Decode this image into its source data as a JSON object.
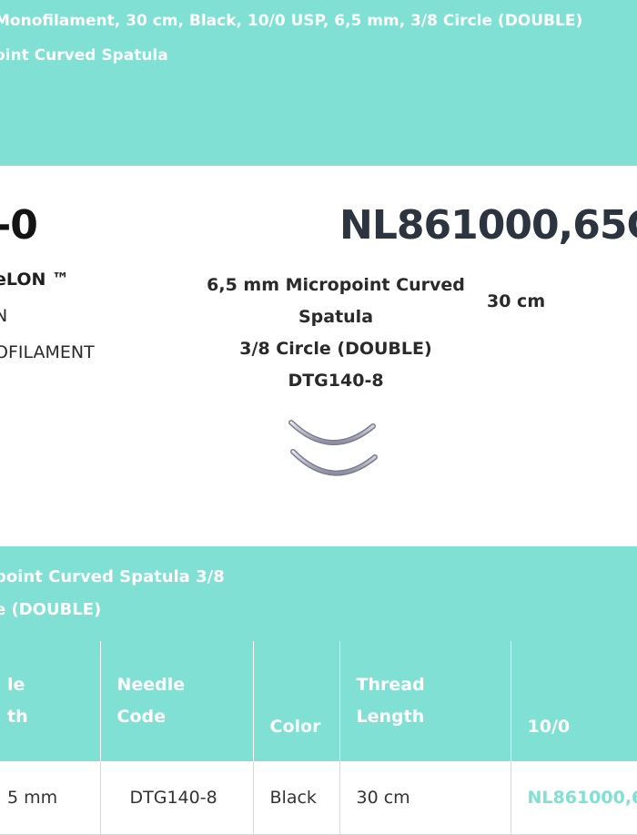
{
  "banner": {
    "title": "Monofilament, 30 cm, Black, 10/0 USP, 6,5 mm, 3/8 Circle (DOUBLE)\noint Curved Spatula"
  },
  "product": {
    "size_label": "-0",
    "code": "NL861000,65G",
    "brand": "eLON ™",
    "material_lines": [
      "N",
      "OFILAMENT"
    ],
    "needle": {
      "line1": "6,5 mm Micropoint Curved",
      "line2": "Spatula",
      "line3": "3/8 Circle (DOUBLE)",
      "line4": "DTG140-8"
    },
    "thread_length": "30 cm"
  },
  "section": {
    "title_line1": "point Curved Spatula 3/8",
    "title_line2": "e (DOUBLE)"
  },
  "table": {
    "headers": [
      {
        "line1": "le",
        "line2": "th"
      },
      {
        "line1": "Needle",
        "line2": "Code"
      },
      {
        "line1": "Color",
        "line2": ""
      },
      {
        "line1": "Thread",
        "line2": "Length"
      },
      {
        "line1": "10/0",
        "line2": ""
      }
    ],
    "rows": [
      {
        "needle_length": "5 mm",
        "needle_code": "DTG140-8",
        "color": "Black",
        "thread_length": "30 cm",
        "code": "NL861000,6"
      }
    ]
  },
  "colors": {
    "accent": "#7fe0d3",
    "text": "#222222"
  }
}
